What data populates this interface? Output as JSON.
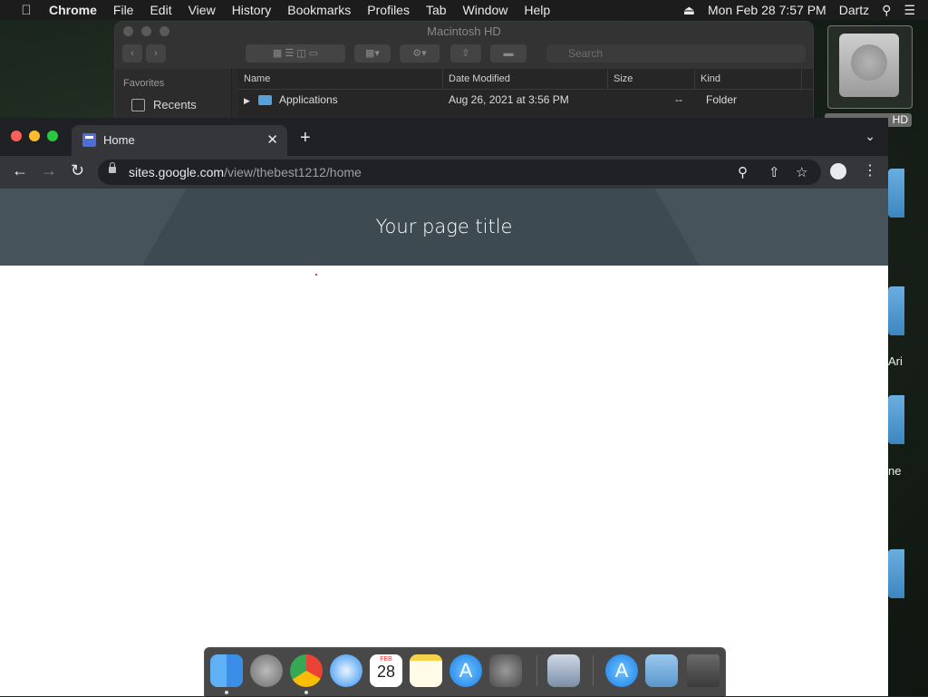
{
  "menubar": {
    "app": "Chrome",
    "items": [
      "File",
      "Edit",
      "View",
      "History",
      "Bookmarks",
      "Profiles",
      "Tab",
      "Window",
      "Help"
    ],
    "datetime": "Mon Feb 28  7:57 PM",
    "user": "Dartz"
  },
  "finder": {
    "title": "Macintosh HD",
    "search_placeholder": "Search",
    "sidebar_section": "Favorites",
    "sidebar_item": "Recents",
    "columns": [
      "Name",
      "Date Modified",
      "Size",
      "Kind"
    ],
    "rows": [
      {
        "name": "Applications",
        "date": "Aug 26, 2021 at 3:56 PM",
        "size": "--",
        "kind": "Folder"
      }
    ]
  },
  "desktop": {
    "disk_label": "HD",
    "partial_labels": [
      "Ari",
      "ne"
    ]
  },
  "chrome": {
    "tab_title": "Home",
    "url_host": "sites.google.com",
    "url_path": "/view/thebest1212/home",
    "page_title": "Your page title"
  },
  "dock": {
    "apps": [
      "Finder",
      "Launchpad",
      "Chrome",
      "Safari",
      "Calendar",
      "Notes",
      "App Store",
      "System Preferences",
      "Preview",
      "Applications",
      "Documents",
      "Trash"
    ],
    "calendar_day": "28",
    "calendar_month": "FEB"
  },
  "colors": {
    "traffic_red": "#ff5f57",
    "traffic_yellow": "#febc2e",
    "traffic_green": "#28c840",
    "header_bg": "#3d4a52"
  }
}
